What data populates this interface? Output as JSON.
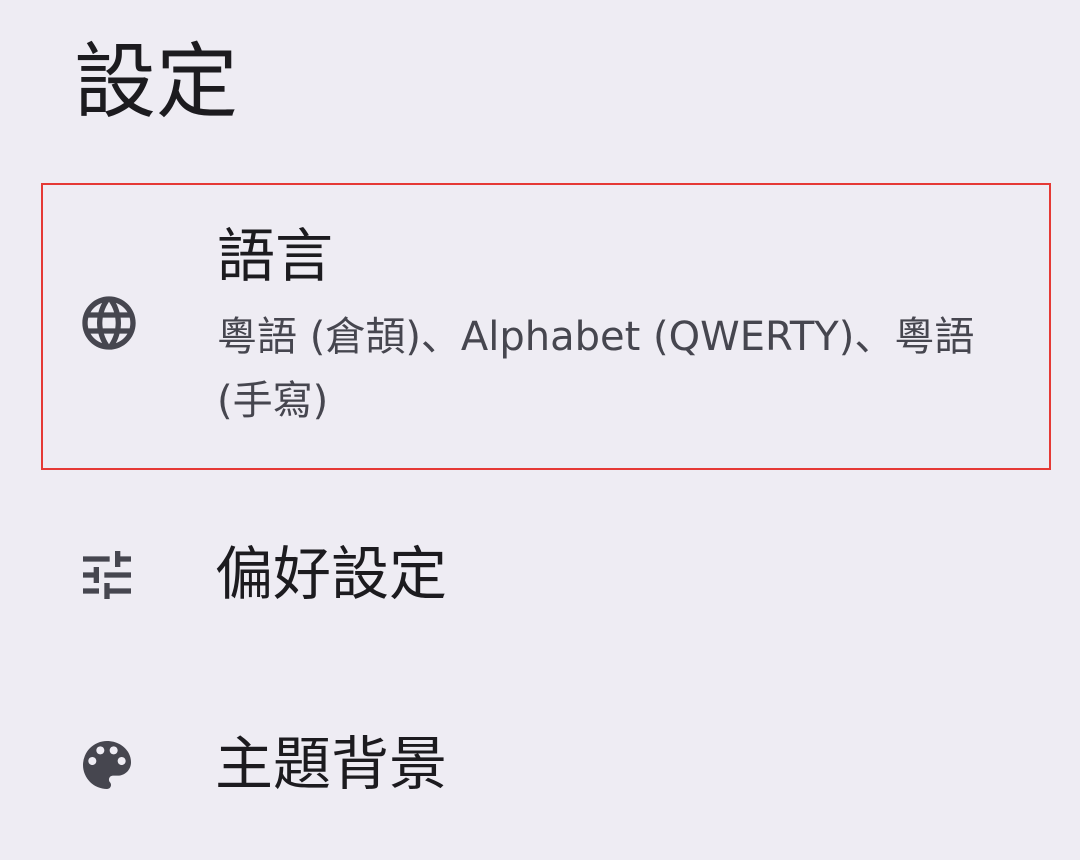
{
  "page": {
    "title": "設定"
  },
  "items": [
    {
      "title": "語言",
      "subtitle": "粵語 (倉頡)、Alphabet (QWERTY)、粵語 (手寫)",
      "icon": "globe-icon"
    },
    {
      "title": "偏好設定",
      "icon": "tune-sliders-icon"
    },
    {
      "title": "主題背景",
      "icon": "palette-icon"
    }
  ],
  "colors": {
    "background": "#eeecf3",
    "text_primary": "#1c1b1f",
    "text_secondary": "#46464f",
    "icon": "#46464f",
    "highlight_border": "#e53935"
  }
}
